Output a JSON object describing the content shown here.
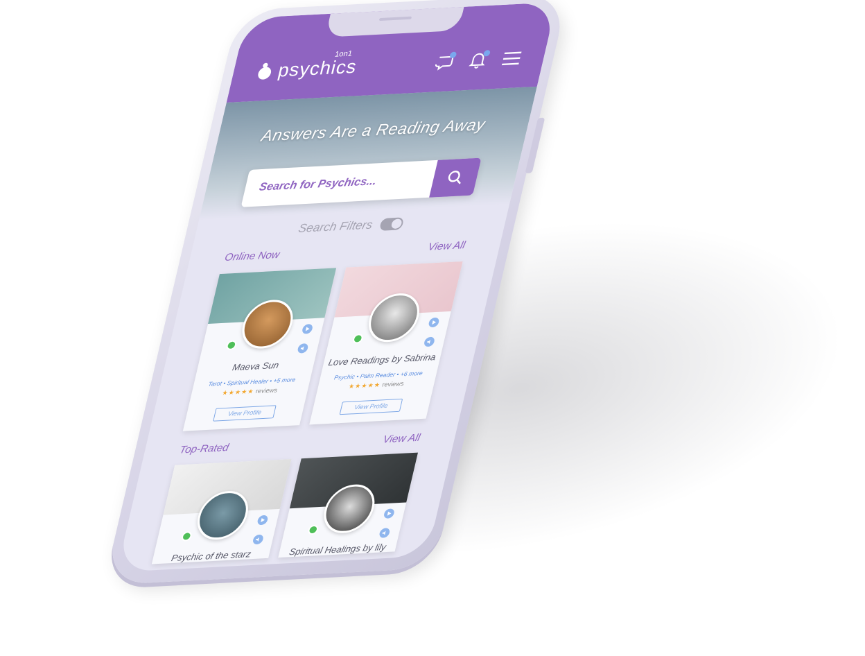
{
  "app": {
    "logo_text": "psychics",
    "logo_sup": "1on1"
  },
  "header": {
    "icons": [
      "chat-icon",
      "bell-icon",
      "menu-icon"
    ]
  },
  "hero": {
    "title": "Answers Are a Reading Away"
  },
  "search": {
    "placeholder": "Search for Psychics...",
    "filters_label": "Search Filters"
  },
  "online_now": {
    "title": "Online Now",
    "view_all": "View All",
    "cards": [
      {
        "name": "Maeva Sun",
        "tags": "Tarot • Spiritual Healer • +5 more",
        "stars": "★★★★★",
        "reviews_label": "reviews",
        "button": "View Profile"
      },
      {
        "name": "Love Readings by Sabrina",
        "tags": "Psychic • Palm Reader • +6 more",
        "stars": "★★★★★",
        "reviews_label": "reviews",
        "button": "View Profile"
      }
    ]
  },
  "top_rated": {
    "title": "Top-Rated",
    "view_all": "View All",
    "cards": [
      {
        "name": "Psychic of the starz"
      },
      {
        "name": "Spiritual Healings by lily"
      }
    ]
  },
  "colors": {
    "brand": "#8f64c1",
    "accent_blue": "#7da7e6",
    "online": "#4fbf59",
    "star": "#f2a72f"
  }
}
